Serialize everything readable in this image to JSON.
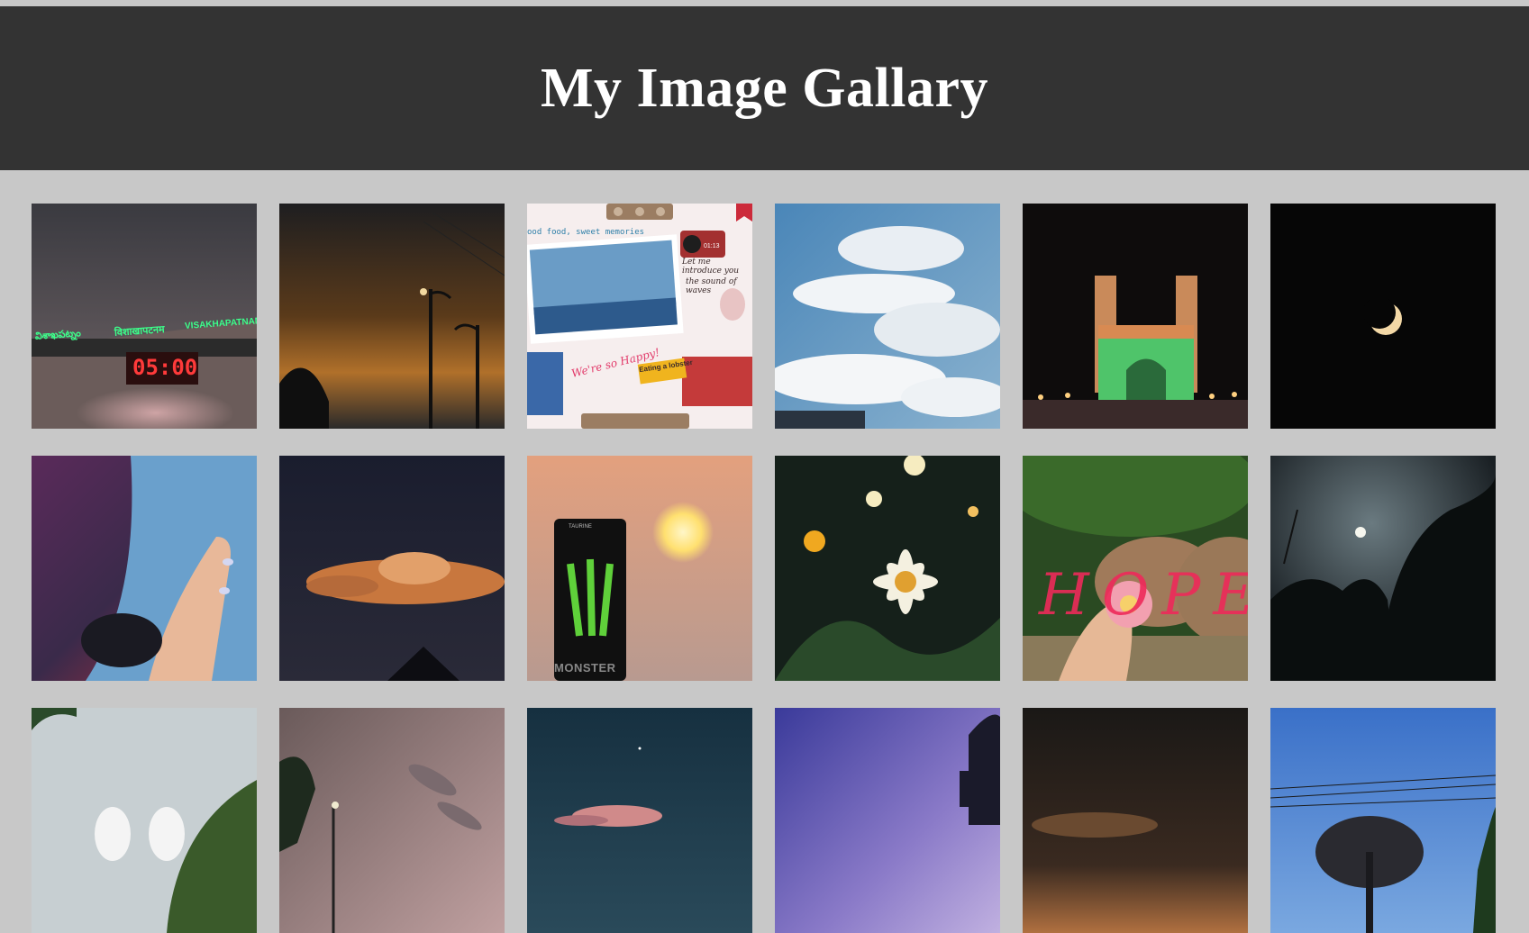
{
  "page": {
    "title": "My Image Gallary"
  },
  "gallery": {
    "images": [
      {
        "subject": "station-sign-night",
        "sign_telugu": "విశాఖపట్నం",
        "sign_hindi": "विशाखापटनम",
        "sign_english": "VISAKHAPATNAM",
        "clock": "05:00"
      },
      {
        "subject": "sunset-streetlights"
      },
      {
        "subject": "scrapbook-collage",
        "heading": "ood food, sweet memories",
        "note_1": "Let me introduce you",
        "note_2": "the sound of waves",
        "note_3": "We're so Happy!",
        "note_4": "Eating a lobster",
        "timer": "01:13"
      },
      {
        "subject": "blue-sky-clouds"
      },
      {
        "subject": "charminar-night"
      },
      {
        "subject": "crescent-moon"
      },
      {
        "subject": "hand-nails-scrunchie"
      },
      {
        "subject": "dusk-cloud"
      },
      {
        "subject": "monster-can-sunset",
        "can_brand": "MONSTER",
        "can_tag": "TAURINE"
      },
      {
        "subject": "wild-flowers"
      },
      {
        "subject": "hope-flower",
        "word": "HOPE"
      },
      {
        "subject": "moon-trees"
      },
      {
        "subject": "statues-sky"
      },
      {
        "subject": "pink-sky-streetlight"
      },
      {
        "subject": "night-sky-cloud"
      },
      {
        "subject": "purple-sky-tower"
      },
      {
        "subject": "dark-sunset"
      },
      {
        "subject": "blue-sky-tree"
      }
    ]
  }
}
